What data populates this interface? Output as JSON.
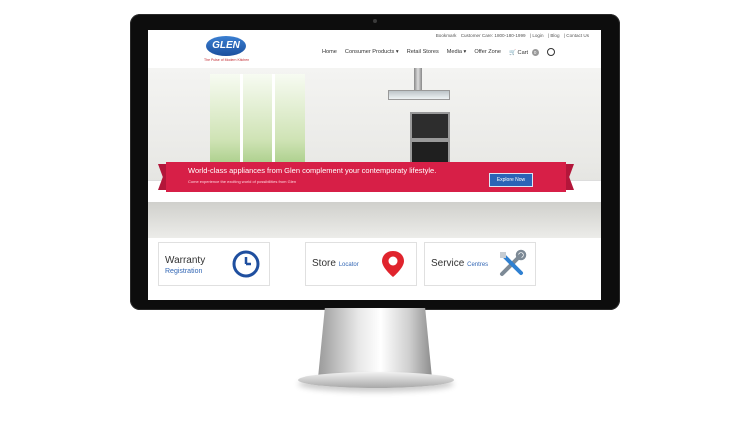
{
  "topbar": {
    "region": "Bookmark",
    "customer_care": "Customer Care: 1800-180-1999",
    "login": "| Login",
    "blog": "| Blog",
    "contact": "| Contact Us"
  },
  "brand": {
    "logo_text": "GLEN",
    "tagline": "The Pulse of Modern Kitchen"
  },
  "nav": {
    "home": "Home",
    "consumer_products": "Consumer Products ▾",
    "retail_stores": "Retail Stores",
    "media": "Media ▾",
    "offer_zone": "Offer Zone",
    "cart": "Cart",
    "cart_count": "0"
  },
  "hero": {
    "headline": "World-class appliances from Glen complement your contemporaty lifestyle.",
    "subline": "Come experience the exciting world of possibilities from Glen",
    "cta": "Explore Now"
  },
  "cards": [
    {
      "title": "Warranty",
      "sub": "Registration",
      "icon": "clock-icon"
    },
    {
      "title": "Store",
      "sub": "Locator",
      "icon": "map-pin-icon"
    },
    {
      "title": "Service",
      "sub": "Centres",
      "icon": "tools-icon"
    }
  ],
  "colors": {
    "brand_red": "#d71f47",
    "brand_blue": "#2b64b6",
    "icon_blue": "#1f4f9f"
  }
}
